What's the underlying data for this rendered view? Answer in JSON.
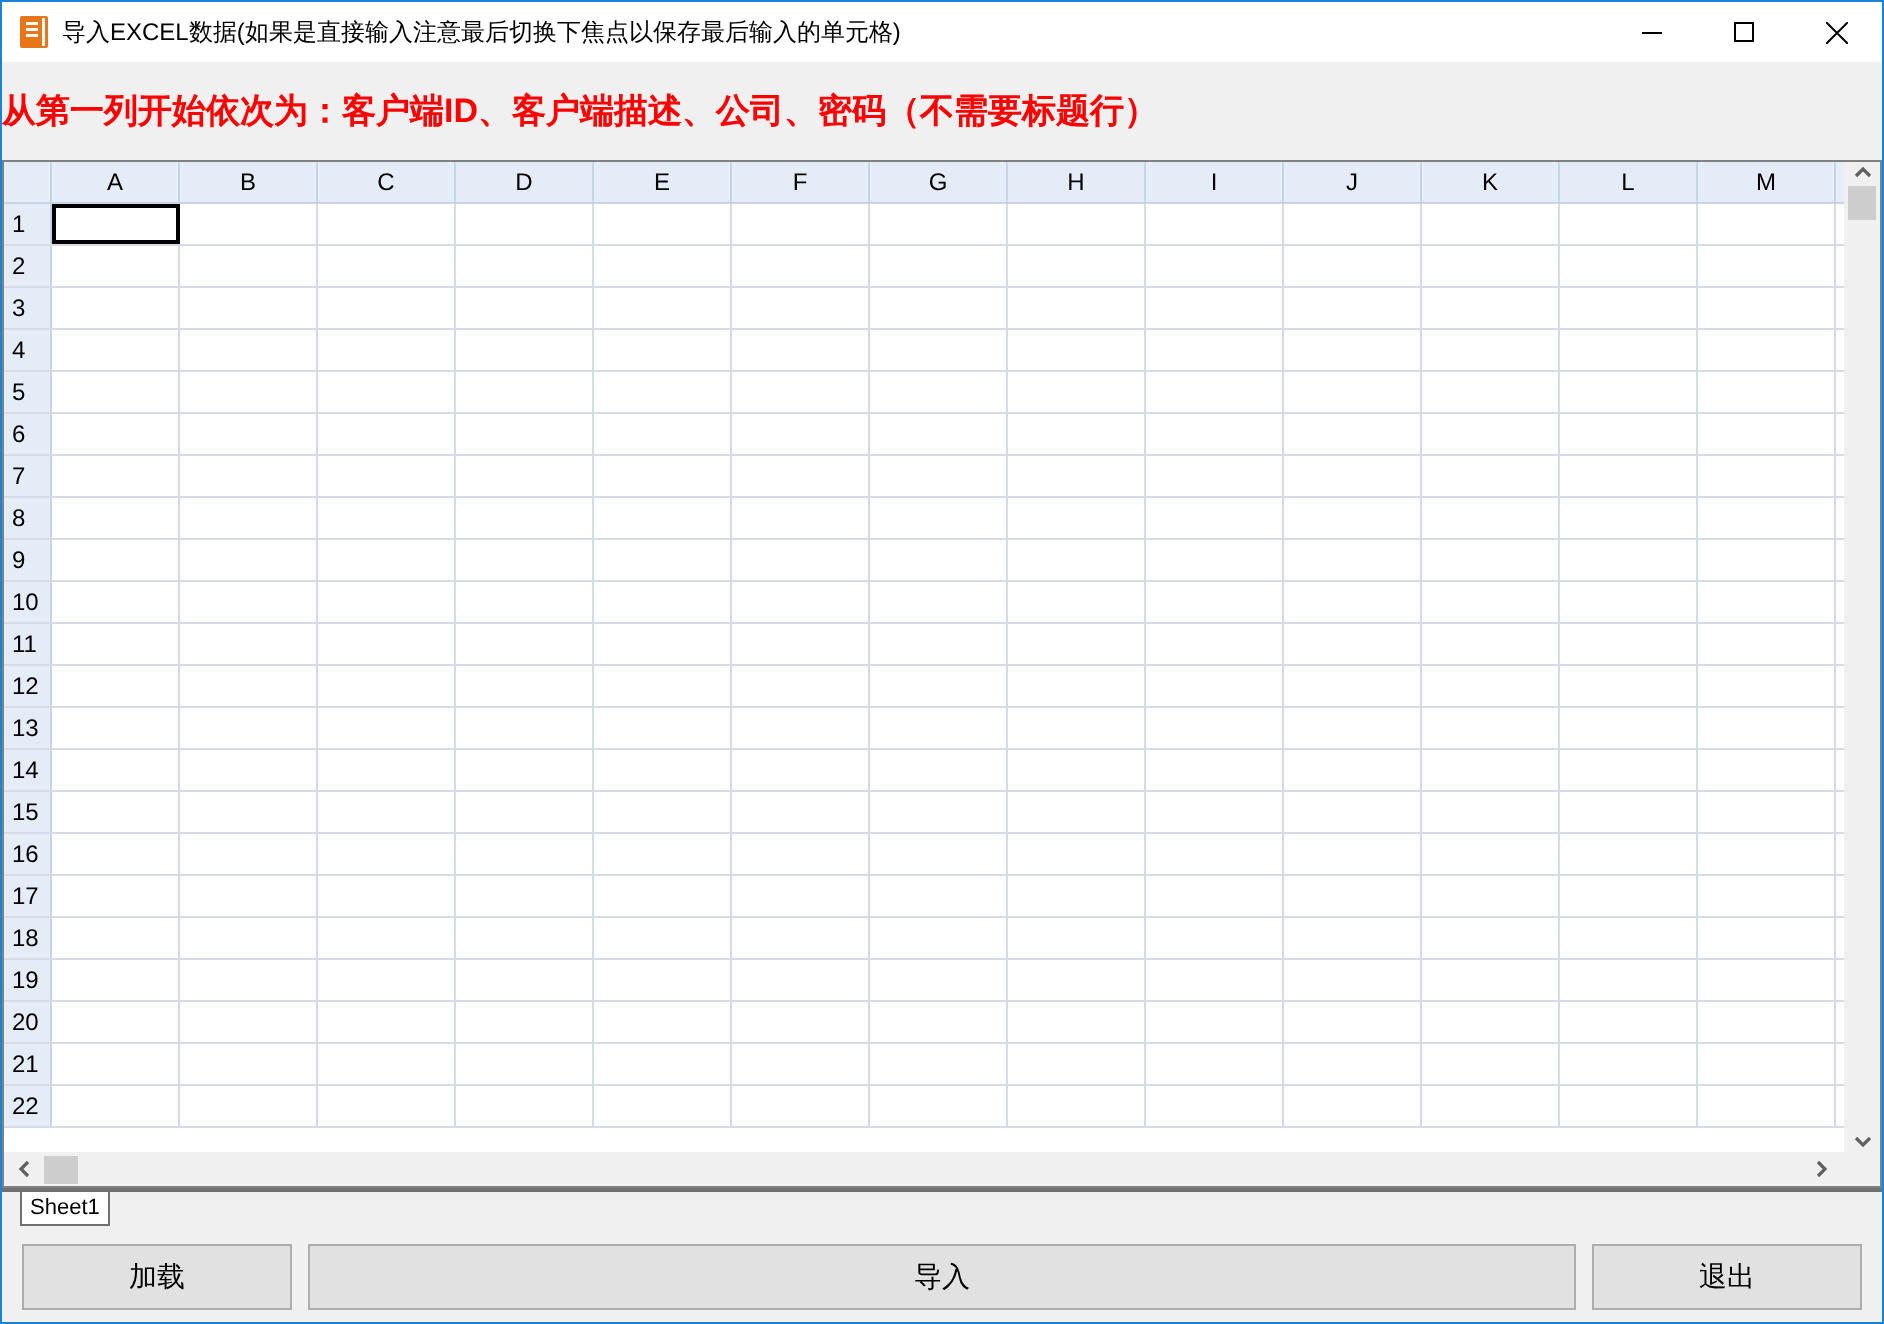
{
  "window": {
    "title": "导入EXCEL数据(如果是直接输入注意最后切换下焦点以保存最后输入的单元格)"
  },
  "instruction": "从第一列开始依次为：客户端ID、客户端描述、公司、密码（不需要标题行）",
  "sheet": {
    "columns": [
      "A",
      "B",
      "C",
      "D",
      "E",
      "F",
      "G",
      "H",
      "I",
      "J",
      "K",
      "L",
      "M"
    ],
    "rows": [
      {
        "label": "1",
        "cells": [
          {
            "selected": true
          }
        ]
      },
      {
        "label": "2"
      },
      {
        "label": "3"
      },
      {
        "label": "4"
      },
      {
        "label": "5"
      },
      {
        "label": "6"
      },
      {
        "label": "7"
      },
      {
        "label": "8"
      },
      {
        "label": "9"
      },
      {
        "label": "10"
      },
      {
        "label": "11"
      },
      {
        "label": "12"
      },
      {
        "label": "13"
      },
      {
        "label": "14"
      },
      {
        "label": "15"
      },
      {
        "label": "16"
      },
      {
        "label": "17"
      },
      {
        "label": "18"
      },
      {
        "label": "19"
      },
      {
        "label": "20"
      },
      {
        "label": "21"
      },
      {
        "label": "22"
      }
    ],
    "tabs": [
      {
        "label": "Sheet1",
        "selected": true
      }
    ]
  },
  "buttons": [
    {
      "label": "加载"
    },
    {
      "label": "导入"
    },
    {
      "label": "退出"
    }
  ]
}
